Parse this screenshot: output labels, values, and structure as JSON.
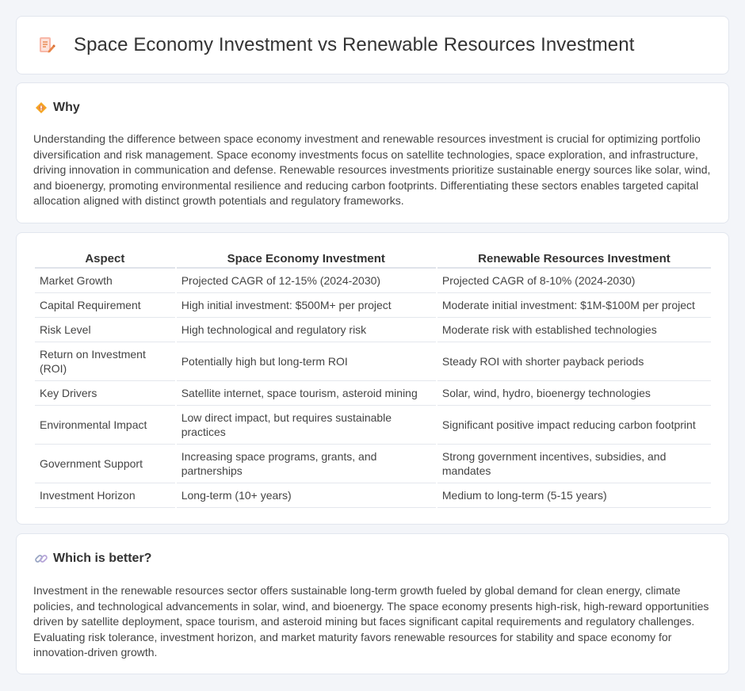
{
  "header": {
    "title": "Space Economy Investment vs Renewable Resources Investment",
    "icon": "document-edit-icon"
  },
  "why": {
    "icon": "diamond-warning-icon",
    "title": "Why",
    "text": "Understanding the difference between space economy investment and renewable resources investment is crucial for optimizing portfolio diversification and risk management. Space economy investments focus on satellite technologies, space exploration, and infrastructure, driving innovation in communication and defense. Renewable resources investments prioritize sustainable energy sources like solar, wind, and bioenergy, promoting environmental resilience and reducing carbon footprints. Differentiating these sectors enables targeted capital allocation aligned with distinct growth potentials and regulatory frameworks."
  },
  "table": {
    "headers": [
      "Aspect",
      "Space Economy Investment",
      "Renewable Resources Investment"
    ],
    "rows": [
      [
        "Market Growth",
        "Projected CAGR of 12-15% (2024-2030)",
        "Projected CAGR of 8-10% (2024-2030)"
      ],
      [
        "Capital Requirement",
        "High initial investment: $500M+ per project",
        "Moderate initial investment: $1M-$100M per project"
      ],
      [
        "Risk Level",
        "High technological and regulatory risk",
        "Moderate risk with established technologies"
      ],
      [
        "Return on Investment (ROI)",
        "Potentially high but long-term ROI",
        "Steady ROI with shorter payback periods"
      ],
      [
        "Key Drivers",
        "Satellite internet, space tourism, asteroid mining",
        "Solar, wind, hydro, bioenergy technologies"
      ],
      [
        "Environmental Impact",
        "Low direct impact, but requires sustainable practices",
        "Significant positive impact reducing carbon footprint"
      ],
      [
        "Government Support",
        "Increasing space programs, grants, and partnerships",
        "Strong government incentives, subsidies, and mandates"
      ],
      [
        "Investment Horizon",
        "Long-term (10+ years)",
        "Medium to long-term (5-15 years)"
      ]
    ]
  },
  "better": {
    "icon": "link-icon",
    "title": "Which is better?",
    "text": "Investment in the renewable resources sector offers sustainable long-term growth fueled by global demand for clean energy, climate policies, and technological advancements in solar, wind, and bioenergy. The space economy presents high-risk, high-reward opportunities driven by satellite deployment, space tourism, and asteroid mining but faces significant capital requirements and regulatory challenges. Evaluating risk tolerance, investment horizon, and market maturity favors renewable resources for stability and space economy for innovation-driven growth."
  },
  "colors": {
    "background": "#f3f5f9",
    "card": "#ffffff",
    "border": "#e2e6ee",
    "icon_orange": "#e8874a",
    "icon_pink": "#f28b82"
  }
}
